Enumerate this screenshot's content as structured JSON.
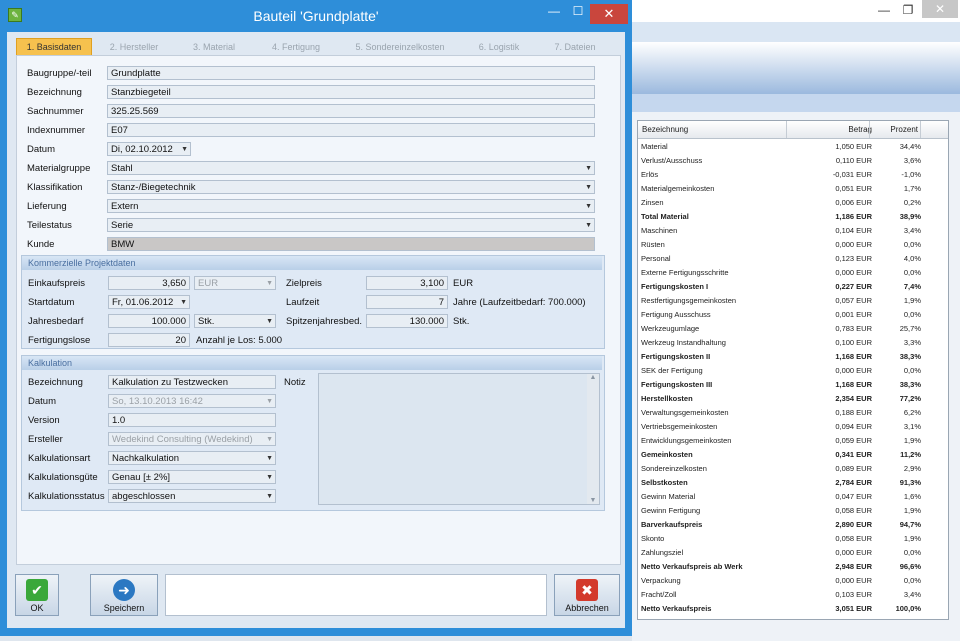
{
  "background_window": {
    "controls": {
      "minimize": "—",
      "maximize": "❐",
      "close": "✕"
    },
    "table": {
      "headers": {
        "name": "Bezeichnung",
        "amount": "Betrag",
        "percent": "Prozent"
      },
      "rows": [
        {
          "name": "Material",
          "amount": "1,050 EUR",
          "percent": "34,4%",
          "bold": false
        },
        {
          "name": "Verlust/Ausschuss",
          "amount": "0,110 EUR",
          "percent": "3,6%",
          "bold": false
        },
        {
          "name": "Erlös",
          "amount": "-0,031 EUR",
          "percent": "-1,0%",
          "bold": false
        },
        {
          "name": "Materialgemeinkosten",
          "amount": "0,051 EUR",
          "percent": "1,7%",
          "bold": false
        },
        {
          "name": "Zinsen",
          "amount": "0,006 EUR",
          "percent": "0,2%",
          "bold": false
        },
        {
          "name": "Total Material",
          "amount": "1,186 EUR",
          "percent": "38,9%",
          "bold": true
        },
        {
          "name": "Maschinen",
          "amount": "0,104 EUR",
          "percent": "3,4%",
          "bold": false
        },
        {
          "name": "Rüsten",
          "amount": "0,000 EUR",
          "percent": "0,0%",
          "bold": false
        },
        {
          "name": "Personal",
          "amount": "0,123 EUR",
          "percent": "4,0%",
          "bold": false
        },
        {
          "name": "Externe Fertigungsschritte",
          "amount": "0,000 EUR",
          "percent": "0,0%",
          "bold": false
        },
        {
          "name": "Fertigungskosten I",
          "amount": "0,227 EUR",
          "percent": "7,4%",
          "bold": true
        },
        {
          "name": "Restfertigungsgemeinkosten",
          "amount": "0,057 EUR",
          "percent": "1,9%",
          "bold": false
        },
        {
          "name": "Fertigung Ausschuss",
          "amount": "0,001 EUR",
          "percent": "0,0%",
          "bold": false
        },
        {
          "name": "Werkzeugumlage",
          "amount": "0,783 EUR",
          "percent": "25,7%",
          "bold": false
        },
        {
          "name": "Werkzeug Instandhaltung",
          "amount": "0,100 EUR",
          "percent": "3,3%",
          "bold": false
        },
        {
          "name": "Fertigungskosten II",
          "amount": "1,168 EUR",
          "percent": "38,3%",
          "bold": true
        },
        {
          "name": "SEK der Fertigung",
          "amount": "0,000 EUR",
          "percent": "0,0%",
          "bold": false
        },
        {
          "name": "Fertigungskosten III",
          "amount": "1,168 EUR",
          "percent": "38,3%",
          "bold": true
        },
        {
          "name": "Herstellkosten",
          "amount": "2,354 EUR",
          "percent": "77,2%",
          "bold": true
        },
        {
          "name": "Verwaltungsgemeinkosten",
          "amount": "0,188 EUR",
          "percent": "6,2%",
          "bold": false
        },
        {
          "name": "Vertriebsgemeinkosten",
          "amount": "0,094 EUR",
          "percent": "3,1%",
          "bold": false
        },
        {
          "name": "Entwicklungsgemeinkosten",
          "amount": "0,059 EUR",
          "percent": "1,9%",
          "bold": false
        },
        {
          "name": "Gemeinkosten",
          "amount": "0,341 EUR",
          "percent": "11,2%",
          "bold": true
        },
        {
          "name": "Sondereinzelkosten",
          "amount": "0,089 EUR",
          "percent": "2,9%",
          "bold": false
        },
        {
          "name": "Selbstkosten",
          "amount": "2,784 EUR",
          "percent": "91,3%",
          "bold": true
        },
        {
          "name": "Gewinn Material",
          "amount": "0,047 EUR",
          "percent": "1,6%",
          "bold": false
        },
        {
          "name": "Gewinn Fertigung",
          "amount": "0,058 EUR",
          "percent": "1,9%",
          "bold": false
        },
        {
          "name": "Barverkaufspreis",
          "amount": "2,890 EUR",
          "percent": "94,7%",
          "bold": true
        },
        {
          "name": "Skonto",
          "amount": "0,058 EUR",
          "percent": "1,9%",
          "bold": false
        },
        {
          "name": "Zahlungsziel",
          "amount": "0,000 EUR",
          "percent": "0,0%",
          "bold": false
        },
        {
          "name": "Netto Verkaufspreis ab Werk",
          "amount": "2,948 EUR",
          "percent": "96,6%",
          "bold": true
        },
        {
          "name": "Verpackung",
          "amount": "0,000 EUR",
          "percent": "0,0%",
          "bold": false
        },
        {
          "name": "Fracht/Zoll",
          "amount": "0,103 EUR",
          "percent": "3,4%",
          "bold": false
        },
        {
          "name": "Netto Verkaufspreis",
          "amount": "3,051 EUR",
          "percent": "100,0%",
          "bold": true
        }
      ]
    }
  },
  "dialog": {
    "title": "Bauteil 'Grundplatte'",
    "controls": {
      "minimize": "—",
      "maximize": "☐",
      "close": "✕"
    },
    "tabs": [
      "1. Basisdaten",
      "2. Hersteller",
      "3. Material",
      "4. Fertigung",
      "5. Sondereinzelkosten",
      "6. Logistik",
      "7. Dateien"
    ],
    "basis": {
      "baugruppe": {
        "label": "Baugruppe/-teil",
        "value": "Grundplatte"
      },
      "bezeichnung": {
        "label": "Bezeichnung",
        "value": "Stanzbiegeteil"
      },
      "sachnummer": {
        "label": "Sachnummer",
        "value": "325.25.569"
      },
      "indexnummer": {
        "label": "Indexnummer",
        "value": "E07"
      },
      "datum": {
        "label": "Datum",
        "value": "Di, 02.10.2012"
      },
      "materialgruppe": {
        "label": "Materialgruppe",
        "value": "Stahl"
      },
      "klassifikation": {
        "label": "Klassifikation",
        "value": "Stanz-/Biegetechnik"
      },
      "lieferung": {
        "label": "Lieferung",
        "value": "Extern"
      },
      "teilestatus": {
        "label": "Teilestatus",
        "value": "Serie"
      },
      "kunde": {
        "label": "Kunde",
        "value": "BMW"
      }
    },
    "projekt": {
      "header": "Kommerzielle Projektdaten",
      "einkaufspreis": {
        "label": "Einkaufspreis",
        "value": "3,650",
        "currency": "EUR"
      },
      "zielpreis": {
        "label": "Zielpreis",
        "value": "3,100",
        "unit": "EUR"
      },
      "startdatum": {
        "label": "Startdatum",
        "value": "Fr, 01.06.2012"
      },
      "laufzeit": {
        "label": "Laufzeit",
        "value": "7",
        "unit": "Jahre (Laufzeitbedarf: 700.000)"
      },
      "jahresbedarf": {
        "label": "Jahresbedarf",
        "value": "100.000",
        "unit": "Stk."
      },
      "spitzenjahresbedarf": {
        "label": "Spitzenjahresbed.",
        "value": "130.000",
        "unit": "Stk."
      },
      "fertigungslose": {
        "label": "Fertigungslose",
        "value": "20",
        "note": "Anzahl je Los: 5.000"
      }
    },
    "kalkulation": {
      "header": "Kalkulation",
      "bezeichnung": {
        "label": "Bezeichnung",
        "value": "Kalkulation zu Testzwecken"
      },
      "datum": {
        "label": "Datum",
        "value": "So, 13.10.2013 16:42"
      },
      "version": {
        "label": "Version",
        "value": "1.0"
      },
      "ersteller": {
        "label": "Ersteller",
        "value": "Wedekind Consulting (Wedekind)"
      },
      "kalkulationsart": {
        "label": "Kalkulationsart",
        "value": "Nachkalkulation"
      },
      "kalkulationsguete": {
        "label": "Kalkulationsgüte",
        "value": "Genau [± 2%]"
      },
      "kalkulationsstatus": {
        "label": "Kalkulationsstatus",
        "value": "abgeschlossen"
      },
      "notiz_label": "Notiz"
    },
    "buttons": {
      "ok": "OK",
      "save": "Speichern",
      "cancel": "Abbrechen"
    }
  }
}
